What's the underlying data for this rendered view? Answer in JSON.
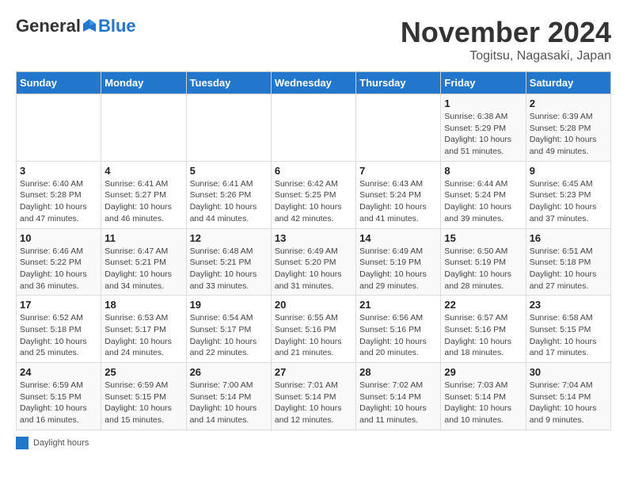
{
  "header": {
    "logo_general": "General",
    "logo_blue": "Blue",
    "month_title": "November 2024",
    "location": "Togitsu, Nagasaki, Japan"
  },
  "days_of_week": [
    "Sunday",
    "Monday",
    "Tuesday",
    "Wednesday",
    "Thursday",
    "Friday",
    "Saturday"
  ],
  "legend_label": "Daylight hours",
  "weeks": [
    [
      {
        "day": "",
        "info": ""
      },
      {
        "day": "",
        "info": ""
      },
      {
        "day": "",
        "info": ""
      },
      {
        "day": "",
        "info": ""
      },
      {
        "day": "",
        "info": ""
      },
      {
        "day": "1",
        "info": "Sunrise: 6:38 AM\nSunset: 5:29 PM\nDaylight: 10 hours and 51 minutes."
      },
      {
        "day": "2",
        "info": "Sunrise: 6:39 AM\nSunset: 5:28 PM\nDaylight: 10 hours and 49 minutes."
      }
    ],
    [
      {
        "day": "3",
        "info": "Sunrise: 6:40 AM\nSunset: 5:28 PM\nDaylight: 10 hours and 47 minutes."
      },
      {
        "day": "4",
        "info": "Sunrise: 6:41 AM\nSunset: 5:27 PM\nDaylight: 10 hours and 46 minutes."
      },
      {
        "day": "5",
        "info": "Sunrise: 6:41 AM\nSunset: 5:26 PM\nDaylight: 10 hours and 44 minutes."
      },
      {
        "day": "6",
        "info": "Sunrise: 6:42 AM\nSunset: 5:25 PM\nDaylight: 10 hours and 42 minutes."
      },
      {
        "day": "7",
        "info": "Sunrise: 6:43 AM\nSunset: 5:24 PM\nDaylight: 10 hours and 41 minutes."
      },
      {
        "day": "8",
        "info": "Sunrise: 6:44 AM\nSunset: 5:24 PM\nDaylight: 10 hours and 39 minutes."
      },
      {
        "day": "9",
        "info": "Sunrise: 6:45 AM\nSunset: 5:23 PM\nDaylight: 10 hours and 37 minutes."
      }
    ],
    [
      {
        "day": "10",
        "info": "Sunrise: 6:46 AM\nSunset: 5:22 PM\nDaylight: 10 hours and 36 minutes."
      },
      {
        "day": "11",
        "info": "Sunrise: 6:47 AM\nSunset: 5:21 PM\nDaylight: 10 hours and 34 minutes."
      },
      {
        "day": "12",
        "info": "Sunrise: 6:48 AM\nSunset: 5:21 PM\nDaylight: 10 hours and 33 minutes."
      },
      {
        "day": "13",
        "info": "Sunrise: 6:49 AM\nSunset: 5:20 PM\nDaylight: 10 hours and 31 minutes."
      },
      {
        "day": "14",
        "info": "Sunrise: 6:49 AM\nSunset: 5:19 PM\nDaylight: 10 hours and 29 minutes."
      },
      {
        "day": "15",
        "info": "Sunrise: 6:50 AM\nSunset: 5:19 PM\nDaylight: 10 hours and 28 minutes."
      },
      {
        "day": "16",
        "info": "Sunrise: 6:51 AM\nSunset: 5:18 PM\nDaylight: 10 hours and 27 minutes."
      }
    ],
    [
      {
        "day": "17",
        "info": "Sunrise: 6:52 AM\nSunset: 5:18 PM\nDaylight: 10 hours and 25 minutes."
      },
      {
        "day": "18",
        "info": "Sunrise: 6:53 AM\nSunset: 5:17 PM\nDaylight: 10 hours and 24 minutes."
      },
      {
        "day": "19",
        "info": "Sunrise: 6:54 AM\nSunset: 5:17 PM\nDaylight: 10 hours and 22 minutes."
      },
      {
        "day": "20",
        "info": "Sunrise: 6:55 AM\nSunset: 5:16 PM\nDaylight: 10 hours and 21 minutes."
      },
      {
        "day": "21",
        "info": "Sunrise: 6:56 AM\nSunset: 5:16 PM\nDaylight: 10 hours and 20 minutes."
      },
      {
        "day": "22",
        "info": "Sunrise: 6:57 AM\nSunset: 5:16 PM\nDaylight: 10 hours and 18 minutes."
      },
      {
        "day": "23",
        "info": "Sunrise: 6:58 AM\nSunset: 5:15 PM\nDaylight: 10 hours and 17 minutes."
      }
    ],
    [
      {
        "day": "24",
        "info": "Sunrise: 6:59 AM\nSunset: 5:15 PM\nDaylight: 10 hours and 16 minutes."
      },
      {
        "day": "25",
        "info": "Sunrise: 6:59 AM\nSunset: 5:15 PM\nDaylight: 10 hours and 15 minutes."
      },
      {
        "day": "26",
        "info": "Sunrise: 7:00 AM\nSunset: 5:14 PM\nDaylight: 10 hours and 14 minutes."
      },
      {
        "day": "27",
        "info": "Sunrise: 7:01 AM\nSunset: 5:14 PM\nDaylight: 10 hours and 12 minutes."
      },
      {
        "day": "28",
        "info": "Sunrise: 7:02 AM\nSunset: 5:14 PM\nDaylight: 10 hours and 11 minutes."
      },
      {
        "day": "29",
        "info": "Sunrise: 7:03 AM\nSunset: 5:14 PM\nDaylight: 10 hours and 10 minutes."
      },
      {
        "day": "30",
        "info": "Sunrise: 7:04 AM\nSunset: 5:14 PM\nDaylight: 10 hours and 9 minutes."
      }
    ]
  ]
}
